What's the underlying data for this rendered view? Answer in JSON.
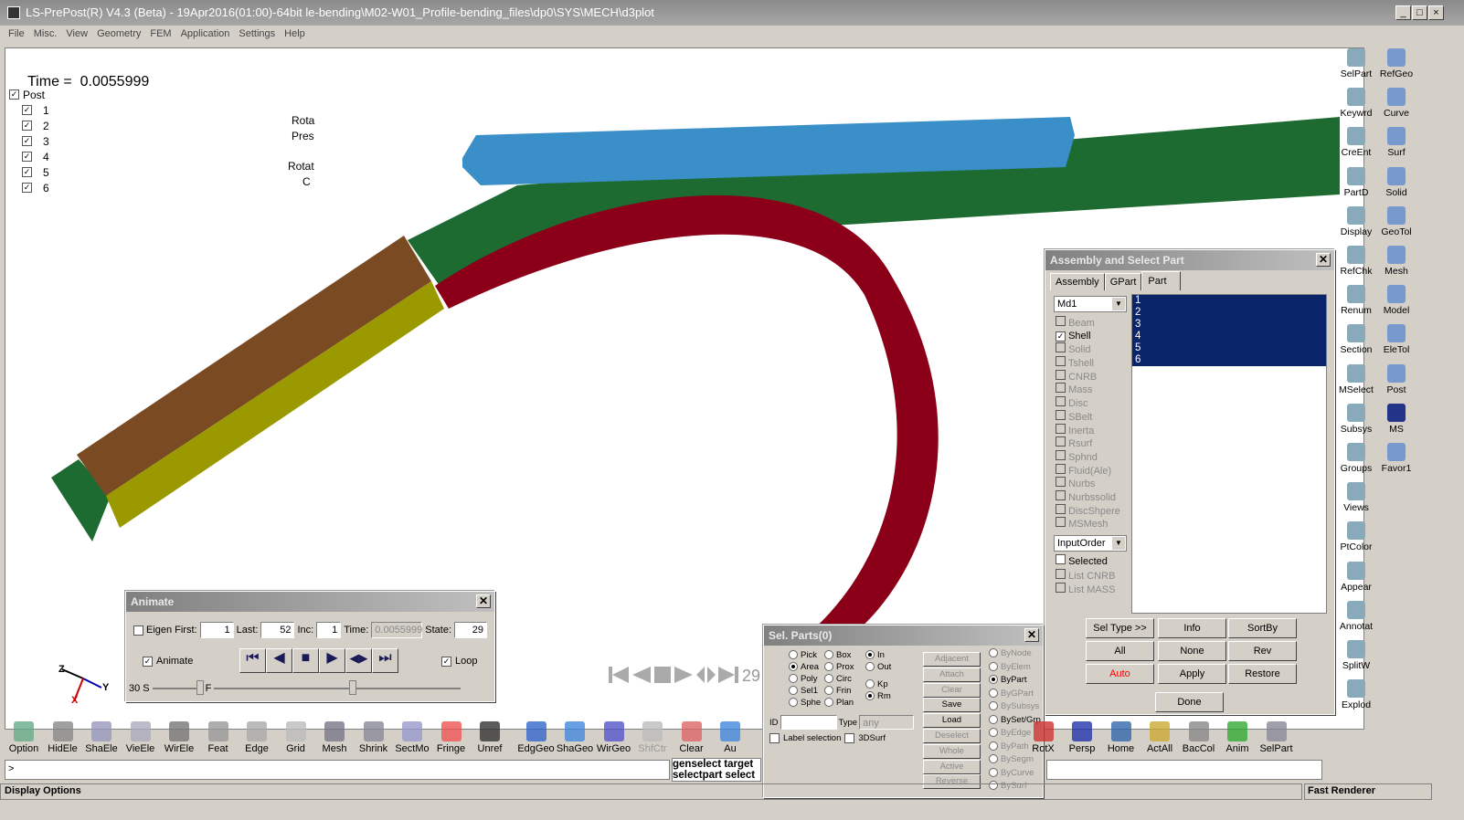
{
  "title": "LS-PrePost(R) V4.3 (Beta) - 19Apr2016(01:00)-64bit le-bending\\M02-W01_Profile-bending_files\\dp0\\SYS\\MECH\\d3plot",
  "window_buttons": [
    "_",
    "□",
    "×"
  ],
  "menu": [
    "File",
    "Misc.",
    "View",
    "Geometry",
    "FEM",
    "Application",
    "Settings",
    "Help"
  ],
  "viewport": {
    "time_label": "Time =",
    "time_value": "0.0055999",
    "tree_root": "Post",
    "parts": [
      "1",
      "2",
      "3",
      "4",
      "5",
      "6"
    ],
    "labels": [
      "Rota",
      "Pres",
      "Rotat",
      "C"
    ],
    "state_readout": "29",
    "axis_z": "Z",
    "axis_y": "Y",
    "axis_x": "X",
    "part_colors": {
      "blue": "#3a8fc8",
      "green": "#1e6b32",
      "red": "#8b0018",
      "brown": "#7a4a22",
      "yellow": "#9a9a00"
    }
  },
  "animate": {
    "title": "Animate",
    "eigen": "Eigen",
    "first_label": "First:",
    "first": "1",
    "last_label": "Last:",
    "last": "52",
    "inc_label": "Inc:",
    "inc": "1",
    "time_label": "Time:",
    "time": "0.0055999",
    "state_label": "State:",
    "state": "29",
    "animate_label": "Animate",
    "loop_label": "Loop",
    "speed": "30",
    "s": "S",
    "f": "F"
  },
  "assembly": {
    "title": "Assembly and Select Part",
    "tabs": [
      "Assembly",
      "GPart",
      "Part"
    ],
    "active_tab": "Part",
    "model": "Md1",
    "types": [
      {
        "l": "Beam",
        "c": false,
        "e": false
      },
      {
        "l": "Shell",
        "c": true,
        "e": true
      },
      {
        "l": "Solid",
        "c": false,
        "e": false
      },
      {
        "l": "Tshell",
        "c": false,
        "e": false
      },
      {
        "l": "CNRB",
        "c": false,
        "e": false
      },
      {
        "l": "Mass",
        "c": false,
        "e": false
      },
      {
        "l": "Disc",
        "c": false,
        "e": false
      },
      {
        "l": "SBelt",
        "c": false,
        "e": false
      },
      {
        "l": "Inerta",
        "c": false,
        "e": false
      },
      {
        "l": "Rsurf",
        "c": false,
        "e": false
      },
      {
        "l": "Sphnd",
        "c": false,
        "e": false
      },
      {
        "l": "Fluid(Ale)",
        "c": false,
        "e": false
      },
      {
        "l": "Nurbs",
        "c": false,
        "e": false
      },
      {
        "l": "Nurbssolid",
        "c": false,
        "e": false
      },
      {
        "l": "DiscShpere",
        "c": false,
        "e": false
      },
      {
        "l": "MSMesh",
        "c": false,
        "e": false
      }
    ],
    "order": "InputOrder",
    "selected": "Selected",
    "list_cnrb": "List CNRB",
    "list_mass": "List MASS",
    "parts": [
      "1",
      "2",
      "3",
      "4",
      "5",
      "6"
    ],
    "buttons": [
      "Sel Type >>",
      "Info",
      "SortBy",
      "All",
      "None",
      "Rev",
      "Auto",
      "Apply",
      "Restore"
    ],
    "done": "Done",
    "auto_color": "#ff0000",
    "selection_color": "#0a246a"
  },
  "selparts": {
    "title": "Sel. Parts(0)",
    "col1": [
      {
        "l": "Pick",
        "on": false
      },
      {
        "l": "Area",
        "on": true
      },
      {
        "l": "Poly",
        "on": false
      },
      {
        "l": "Sel1",
        "on": false
      },
      {
        "l": "Sphe",
        "on": false
      }
    ],
    "col2": [
      {
        "l": "Box",
        "on": false
      },
      {
        "l": "Prox",
        "on": false
      },
      {
        "l": "Circ",
        "on": false
      },
      {
        "l": "Frin",
        "on": false
      },
      {
        "l": "Plan",
        "on": false
      }
    ],
    "col3": [
      {
        "l": "In",
        "on": true
      },
      {
        "l": "Out",
        "on": false
      },
      {
        "l": "Kp",
        "on": false
      },
      {
        "l": "Rm",
        "on": true
      }
    ],
    "id_label": "ID",
    "type_label": "Type",
    "type_value": "any",
    "label_selection": "Label selection",
    "surf3d": "3DSurf",
    "actions": [
      {
        "l": "Adjacent",
        "e": false
      },
      {
        "l": "Attach",
        "e": false
      },
      {
        "l": "Clear",
        "e": false
      },
      {
        "l": "Save",
        "e": true
      },
      {
        "l": "Load",
        "e": true
      },
      {
        "l": "Deselect",
        "e": false
      },
      {
        "l": "Whole",
        "e": false
      },
      {
        "l": "Active",
        "e": false
      },
      {
        "l": "Reverse",
        "e": false
      }
    ],
    "by": [
      {
        "l": "ByNode",
        "on": false,
        "e": false
      },
      {
        "l": "ByElem",
        "on": false,
        "e": false
      },
      {
        "l": "ByPart",
        "on": true,
        "e": true
      },
      {
        "l": "ByGPart",
        "on": false,
        "e": false
      },
      {
        "l": "BySubsys",
        "on": false,
        "e": false
      },
      {
        "l": "BySet/Grp",
        "on": false,
        "e": true
      },
      {
        "l": "ByEdge",
        "on": false,
        "e": false
      },
      {
        "l": "ByPath",
        "on": false,
        "e": false
      },
      {
        "l": "BySegm",
        "on": false,
        "e": false
      },
      {
        "l": "ByCurve",
        "on": false,
        "e": false
      },
      {
        "l": "BySurf",
        "on": false,
        "e": false
      }
    ]
  },
  "bottom_toolbar": [
    "Option",
    "HidEle",
    "ShaEle",
    "VieEle",
    "WirEle",
    "Feat",
    "Edge",
    "Grid",
    "Mesh",
    "Shrink",
    "SectMo",
    "Fringe",
    "Unref",
    "EdgGeo",
    "ShaGeo",
    "WirGeo",
    "ShfCtr",
    "Clear",
    "Au",
    "RotX",
    "Persp",
    "Home",
    "ActAll",
    "BacCol",
    "Anim",
    "SelPart"
  ],
  "right_toolbar_left": [
    "SelPart",
    "Keywrd",
    "CreEnt",
    "PartD",
    "Display",
    "RefChk",
    "Renum",
    "Section",
    "MSelect",
    "Subsys",
    "Groups",
    "Views",
    "PtColor",
    "Appear",
    "Annotat",
    "SplitW",
    "Explod"
  ],
  "right_toolbar_right": [
    "RefGeo",
    "Curve",
    "Surf",
    "Solid",
    "GeoTol",
    "Mesh",
    "Model",
    "EleTol",
    "Post",
    "MS",
    "Favor1"
  ],
  "command": {
    "prompt": ">",
    "history": [
      "genselect target",
      "selectpart select"
    ]
  },
  "status": {
    "left": "Display Options",
    "right": "Fast Renderer"
  }
}
